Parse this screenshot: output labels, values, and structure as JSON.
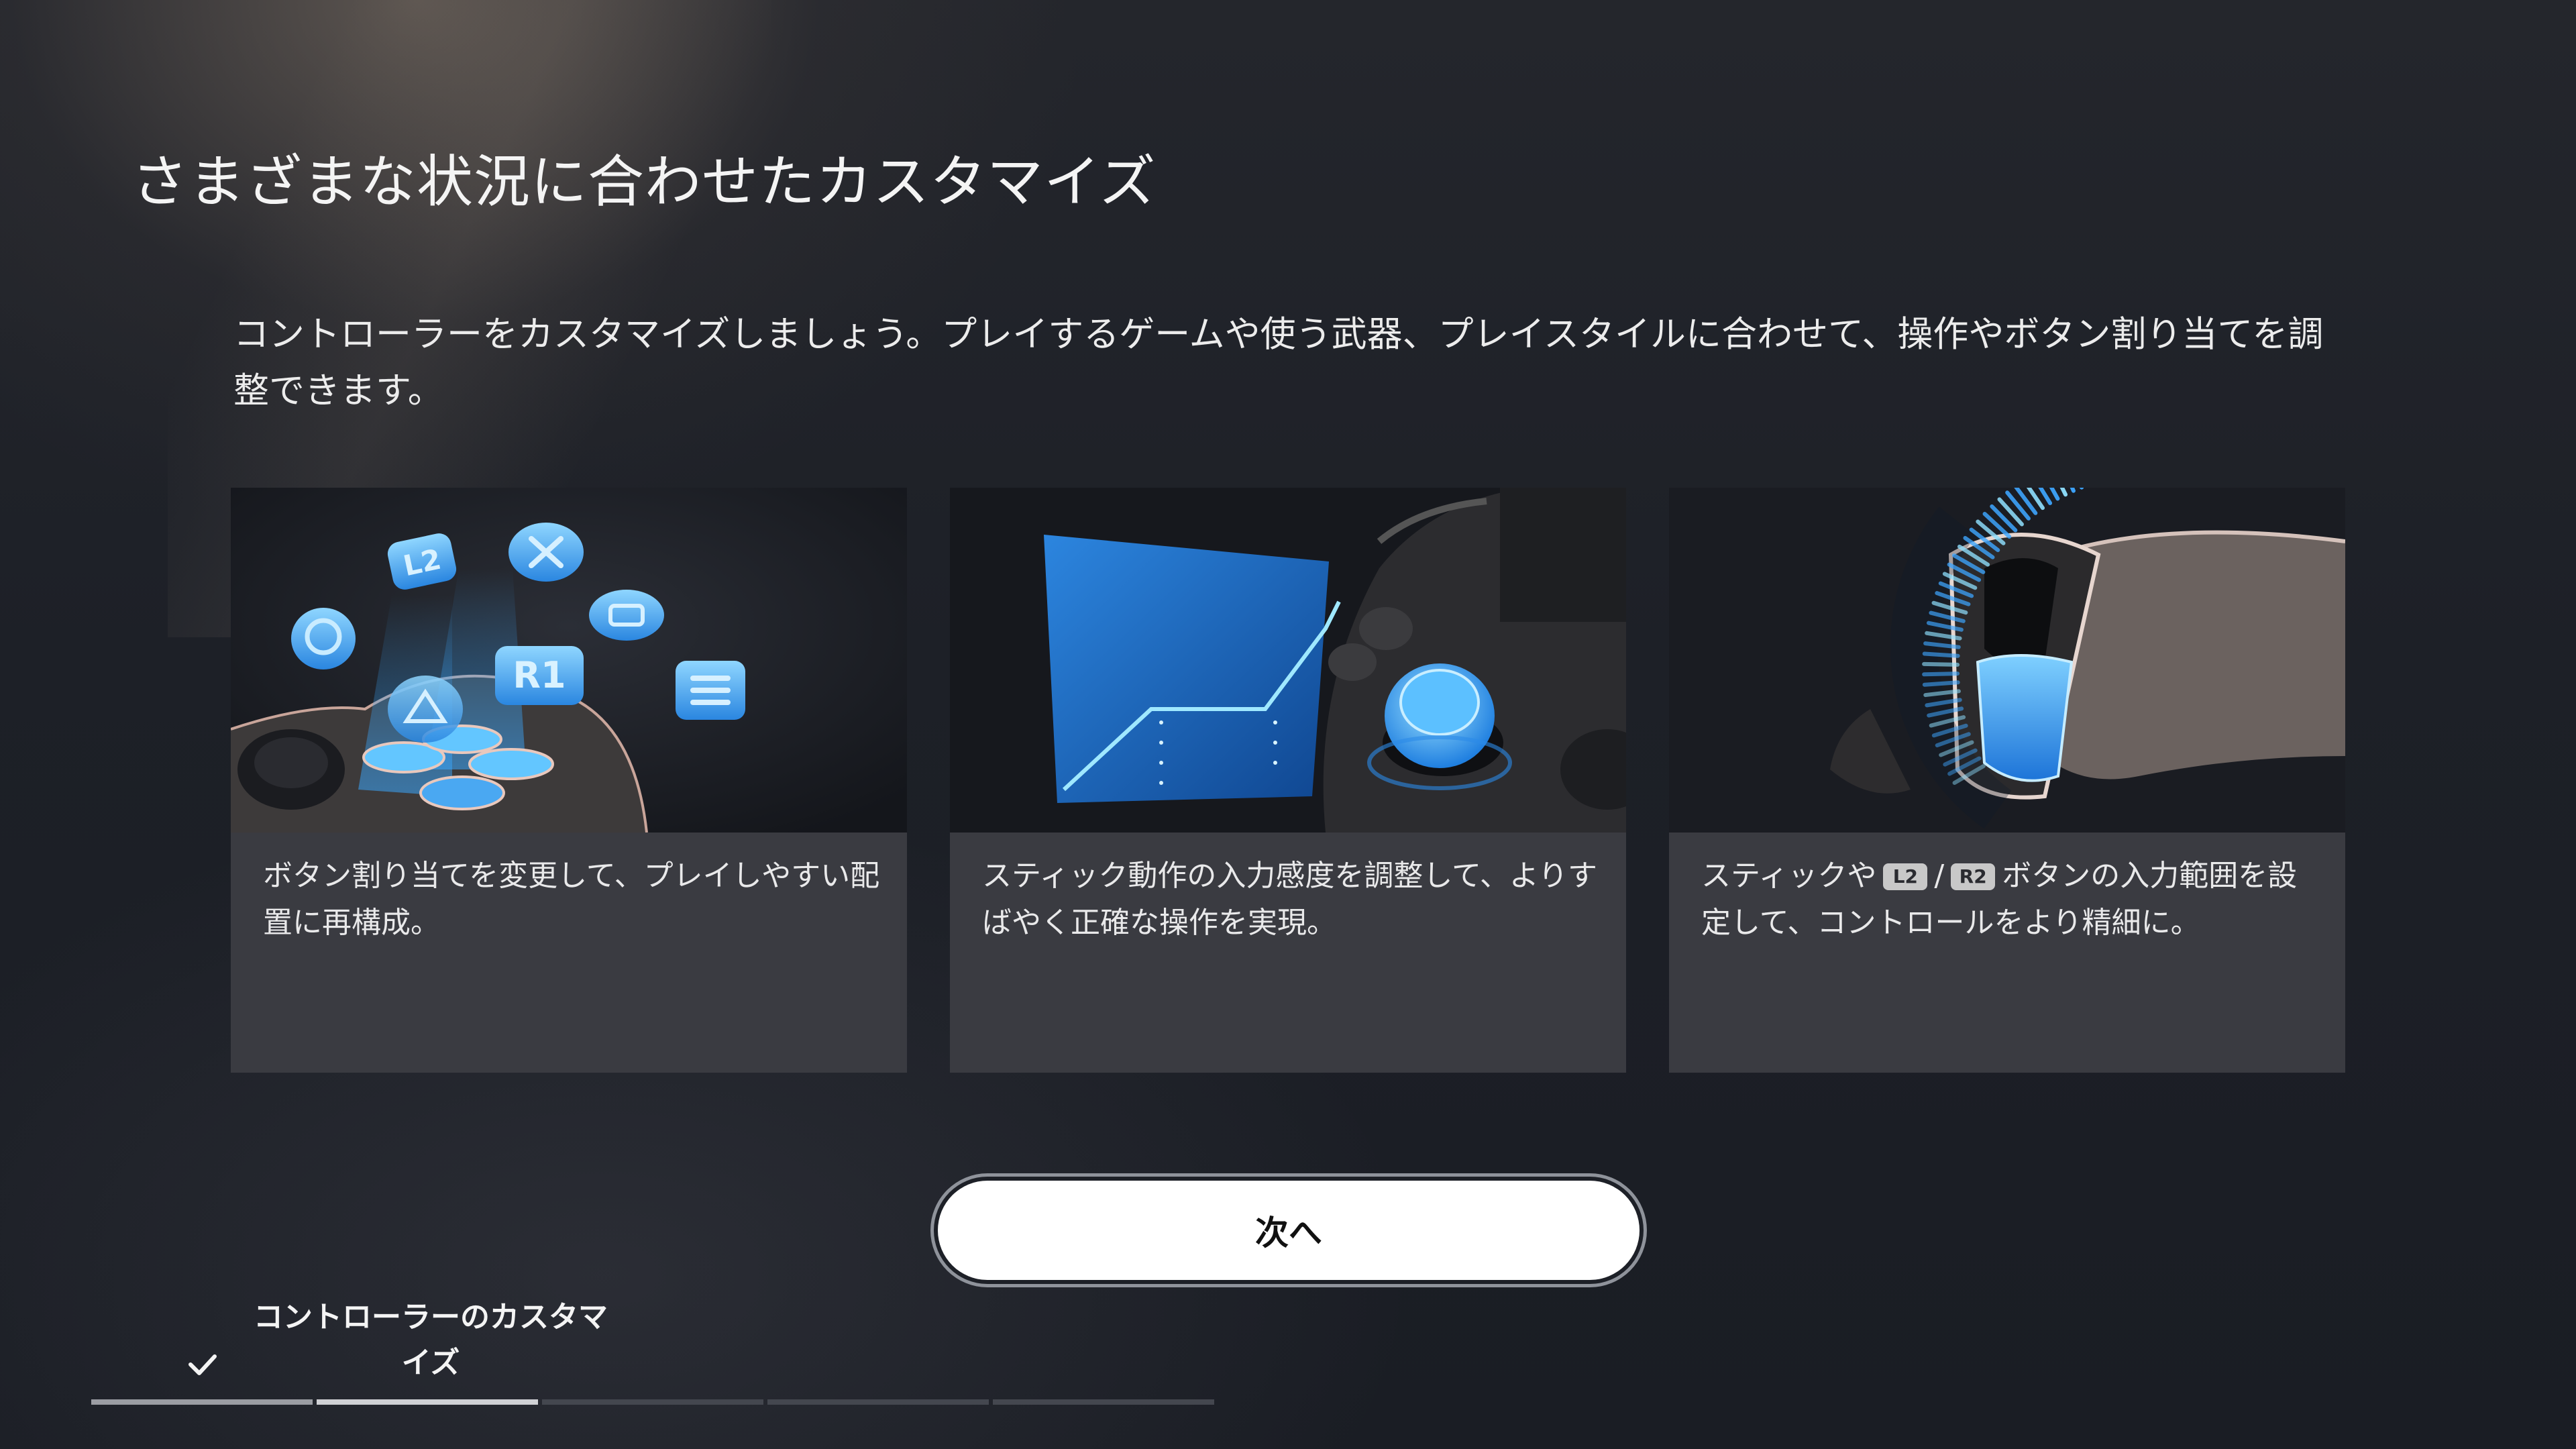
{
  "page": {
    "title": "さまざまな状況に合わせたカスタマイズ",
    "description": "コントローラーをカスタマイズしましょう。プレイするゲームや使う武器、プレイスタイルに合わせて、操作やボタン割り当てを調整できます。"
  },
  "cards": [
    {
      "text": "ボタン割り当てを変更して、プレイしやすい配置に再構成。",
      "art_labels": [
        "L2",
        "R1"
      ]
    },
    {
      "text": "スティック動作の入力感度を調整して、よりすばやく正確な操作を実現。"
    },
    {
      "text_before": "スティックや",
      "badge_left": "L2",
      "separator": "/",
      "badge_right": "R2",
      "text_after": "ボタンの入力範囲を設定して、コントロールをより精細に。"
    }
  ],
  "buttons": {
    "next_label": "次へ"
  },
  "progress": {
    "step_label": "コントローラーのカスタマイズ",
    "total_steps": 5,
    "completed_steps": 2,
    "current_step": 2
  },
  "icons": {
    "check": "check-icon",
    "card1": "button-remap-illustration",
    "card2": "stick-sensitivity-illustration",
    "card3": "trigger-range-illustration"
  },
  "colors": {
    "accent_blue": "#2f8de8",
    "glow_blue": "#63c6ff",
    "card_background": "#3a3b41",
    "button_background": "#ffffff"
  }
}
